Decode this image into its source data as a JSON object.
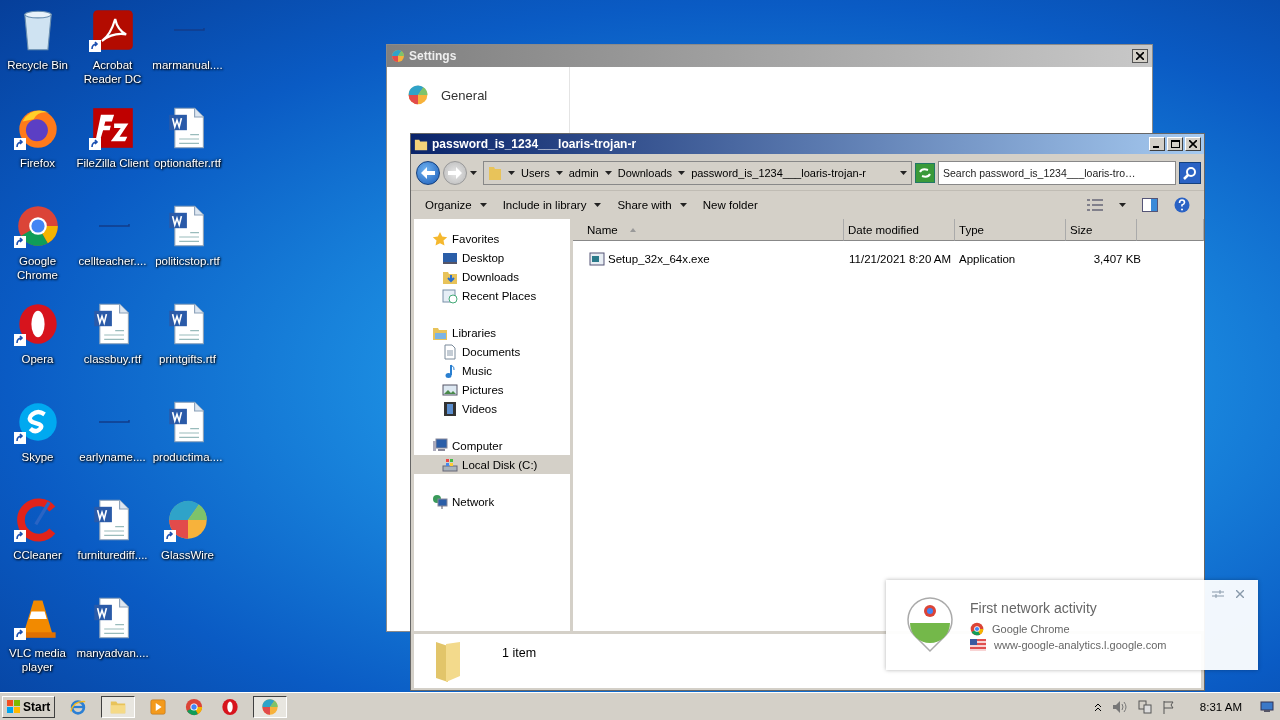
{
  "desktop_icons": [
    {
      "label": "Recycle Bin",
      "kind": "recycle",
      "shortcut": false
    },
    {
      "label": "Firefox",
      "kind": "firefox",
      "shortcut": true
    },
    {
      "label": "Google Chrome",
      "kind": "chrome",
      "shortcut": true
    },
    {
      "label": "Opera",
      "kind": "opera",
      "shortcut": true
    },
    {
      "label": "Skype",
      "kind": "skype",
      "shortcut": true
    },
    {
      "label": "CCleaner",
      "kind": "ccleaner",
      "shortcut": true
    },
    {
      "label": "VLC media player",
      "kind": "vlc",
      "shortcut": true
    },
    {
      "label": "Acrobat Reader DC",
      "kind": "acrobat",
      "shortcut": true
    },
    {
      "label": "FileZilla Client",
      "kind": "filezilla",
      "shortcut": true
    },
    {
      "label": "cellteacher....",
      "kind": "blank",
      "shortcut": false
    },
    {
      "label": "classbuy.rtf",
      "kind": "word",
      "shortcut": false
    },
    {
      "label": "earlyname....",
      "kind": "blank",
      "shortcut": false
    },
    {
      "label": "furniturediff....",
      "kind": "word",
      "shortcut": false
    },
    {
      "label": "manyadvan....",
      "kind": "word",
      "shortcut": false
    },
    {
      "label": "marmanual....",
      "kind": "blank",
      "shortcut": false
    },
    {
      "label": "optionafter.rtf",
      "kind": "word",
      "shortcut": false
    },
    {
      "label": "politicstop.rtf",
      "kind": "word",
      "shortcut": false
    },
    {
      "label": "printgifts.rtf",
      "kind": "word",
      "shortcut": false
    },
    {
      "label": "productima....",
      "kind": "word",
      "shortcut": false
    },
    {
      "label": "GlassWire",
      "kind": "glasswire",
      "shortcut": true
    }
  ],
  "settings_window": {
    "title": "Settings",
    "sidebar_items": [
      {
        "label": "General",
        "selected": false
      }
    ]
  },
  "explorer": {
    "title": "password_is_1234___loaris-trojan-r",
    "breadcrumb": [
      "Users",
      "admin",
      "Downloads",
      "password_is_1234___loaris-trojan-r"
    ],
    "search": {
      "placeholder": "Search password_is_1234___loaris-tro…"
    },
    "toolbar": [
      {
        "label": "Organize",
        "dropdown": true
      },
      {
        "label": "Include in library",
        "dropdown": true
      },
      {
        "label": "Share with",
        "dropdown": true
      },
      {
        "label": "New folder",
        "dropdown": false
      }
    ],
    "nav": [
      {
        "label": "Favorites",
        "kind": "star",
        "selected": false,
        "children": [
          {
            "label": "Desktop",
            "kind": "desktop",
            "selected": false
          },
          {
            "label": "Downloads",
            "kind": "downloads",
            "selected": false
          },
          {
            "label": "Recent Places",
            "kind": "recent",
            "selected": false
          }
        ]
      },
      {
        "label": "Libraries",
        "kind": "libraries",
        "selected": false,
        "children": [
          {
            "label": "Documents",
            "kind": "documents",
            "selected": false
          },
          {
            "label": "Music",
            "kind": "music",
            "selected": false
          },
          {
            "label": "Pictures",
            "kind": "pictures",
            "selected": false
          },
          {
            "label": "Videos",
            "kind": "videos",
            "selected": false
          }
        ]
      },
      {
        "label": "Computer",
        "kind": "computer",
        "selected": false,
        "children": [
          {
            "label": "Local Disk (C:)",
            "kind": "disk",
            "selected": true
          }
        ]
      },
      {
        "label": "Network",
        "kind": "network",
        "selected": false
      }
    ],
    "columns": [
      {
        "label": "Name",
        "sorted": true
      },
      {
        "label": "Date modified",
        "sorted": false
      },
      {
        "label": "Type",
        "sorted": false
      },
      {
        "label": "Size",
        "sorted": false
      }
    ],
    "rows": [
      {
        "name": "Setup_32x_64x.exe",
        "date": "11/21/2021 8:20 AM",
        "type": "Application",
        "size": "3,407 KB",
        "selected": false
      }
    ],
    "status": "1 item"
  },
  "notification": {
    "title": "First network activity",
    "app": "Google Chrome",
    "host": "www-google-analytics.l.google.com"
  },
  "taskbar": {
    "start": "Start",
    "apps": [
      {
        "kind": "ie",
        "active": false
      },
      {
        "kind": "explorer",
        "active": true
      },
      {
        "kind": "media",
        "active": false
      },
      {
        "kind": "chrome",
        "active": false
      },
      {
        "kind": "opera",
        "active": false
      },
      {
        "kind": "glasswire",
        "active": true
      }
    ],
    "clock": "8:31 AM"
  }
}
